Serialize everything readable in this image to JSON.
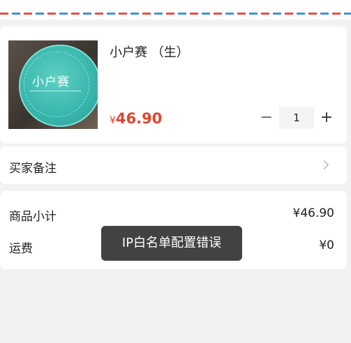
{
  "product": {
    "name": "小户赛 （生）",
    "image_text": "小户赛",
    "price_symbol": "¥",
    "price_value": "46.90",
    "quantity": "1",
    "minus_label": "−",
    "plus_label": "+"
  },
  "note": {
    "label": "买家备注"
  },
  "summary": {
    "subtotal_label": "商品小计",
    "subtotal_value": "¥46.90",
    "shipping_label": "运费",
    "shipping_value": "¥0"
  },
  "toast": {
    "message": "IP白名单配置错误"
  },
  "colors": {
    "price": "#e0452f",
    "toast_bg": "#282828"
  }
}
